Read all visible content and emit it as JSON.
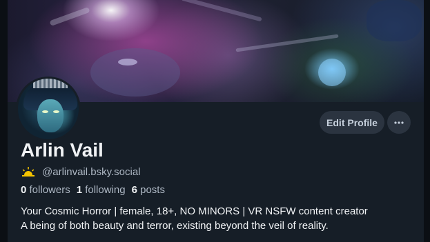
{
  "profile": {
    "display_name": "Arlin Vail",
    "handle": "@arlinvail.bsky.social",
    "stats": {
      "followers_count": "0",
      "followers_label": "followers",
      "following_count": "1",
      "following_label": "following",
      "posts_count": "6",
      "posts_label": "posts"
    },
    "bio": [
      "Your Cosmic Horror | female, 18+, NO MINORS | VR NSFW content creator",
      "A being of both beauty and terror, existing beyond the veil of reality."
    ]
  },
  "actions": {
    "edit_profile_label": "Edit Profile",
    "more_icon": "ellipsis-icon"
  },
  "icons": {
    "handle_prefix": "sun-icon",
    "handle_prefix_color": "#f5c400"
  },
  "colors": {
    "background": "#161e27",
    "button_bg": "#2b3440",
    "text_primary": "#f1f3f5",
    "text_secondary": "#aeb8c4"
  }
}
